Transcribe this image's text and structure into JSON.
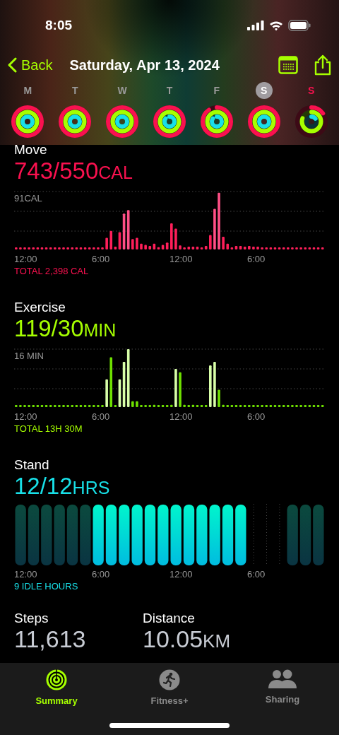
{
  "status_bar": {
    "time": "8:05"
  },
  "nav": {
    "back": "Back",
    "title": "Saturday, Apr 13, 2024"
  },
  "week": [
    {
      "label": "M",
      "selected": false,
      "today": false
    },
    {
      "label": "T",
      "selected": false,
      "today": false
    },
    {
      "label": "W",
      "selected": false,
      "today": false
    },
    {
      "label": "T",
      "selected": false,
      "today": false
    },
    {
      "label": "F",
      "selected": false,
      "today": false
    },
    {
      "label": "S",
      "selected": true,
      "today": false
    },
    {
      "label": "S",
      "selected": false,
      "today": true
    }
  ],
  "sections": [
    {
      "kind": "move",
      "title": "Move",
      "value": "743/550",
      "unit": "CAL",
      "scale_label": "91CAL",
      "axis_labels": [
        "12:00",
        "6:00",
        "12:00",
        "6:00"
      ],
      "total": "TOTAL 2,398 CAL"
    },
    {
      "kind": "exercise",
      "title": "Exercise",
      "value": "119/30",
      "unit": "MIN",
      "scale_label": "16 MIN",
      "axis_labels": [
        "12:00",
        "6:00",
        "12:00",
        "6:00"
      ],
      "total": "TOTAL 13H 30M"
    },
    {
      "kind": "stand",
      "title": "Stand",
      "value": "12/12",
      "unit": "HRS",
      "axis_labels": [
        "12:00",
        "6:00",
        "12:00",
        "6:00"
      ],
      "total": "9 IDLE HOURS",
      "hours": [
        {
          "kind": "idle"
        },
        {
          "kind": "idle"
        },
        {
          "kind": "idle"
        },
        {
          "kind": "idle"
        },
        {
          "kind": "idle"
        },
        {
          "kind": "idle"
        },
        {
          "kind": "stood"
        },
        {
          "kind": "stood"
        },
        {
          "kind": "stood"
        },
        {
          "kind": "stood"
        },
        {
          "kind": "stood"
        },
        {
          "kind": "stood"
        },
        {
          "kind": "stood"
        },
        {
          "kind": "stood"
        },
        {
          "kind": "stood"
        },
        {
          "kind": "stood"
        },
        {
          "kind": "stood"
        },
        {
          "kind": "stood"
        },
        {
          "kind": "none"
        },
        {
          "kind": "none"
        },
        {
          "kind": "none"
        },
        {
          "kind": "idle"
        },
        {
          "kind": "idle"
        },
        {
          "kind": "idle"
        }
      ]
    }
  ],
  "stats": [
    {
      "label": "Steps",
      "value": "11,613"
    },
    {
      "label": "Distance",
      "value": "10.05",
      "unit": "KM"
    }
  ],
  "tabs": [
    {
      "kind": "summary",
      "label": "Summary",
      "selected": true
    },
    {
      "kind": "fitness",
      "label": "Fitness+",
      "selected": false
    },
    {
      "kind": "sharing",
      "label": "Sharing",
      "selected": false
    }
  ]
}
